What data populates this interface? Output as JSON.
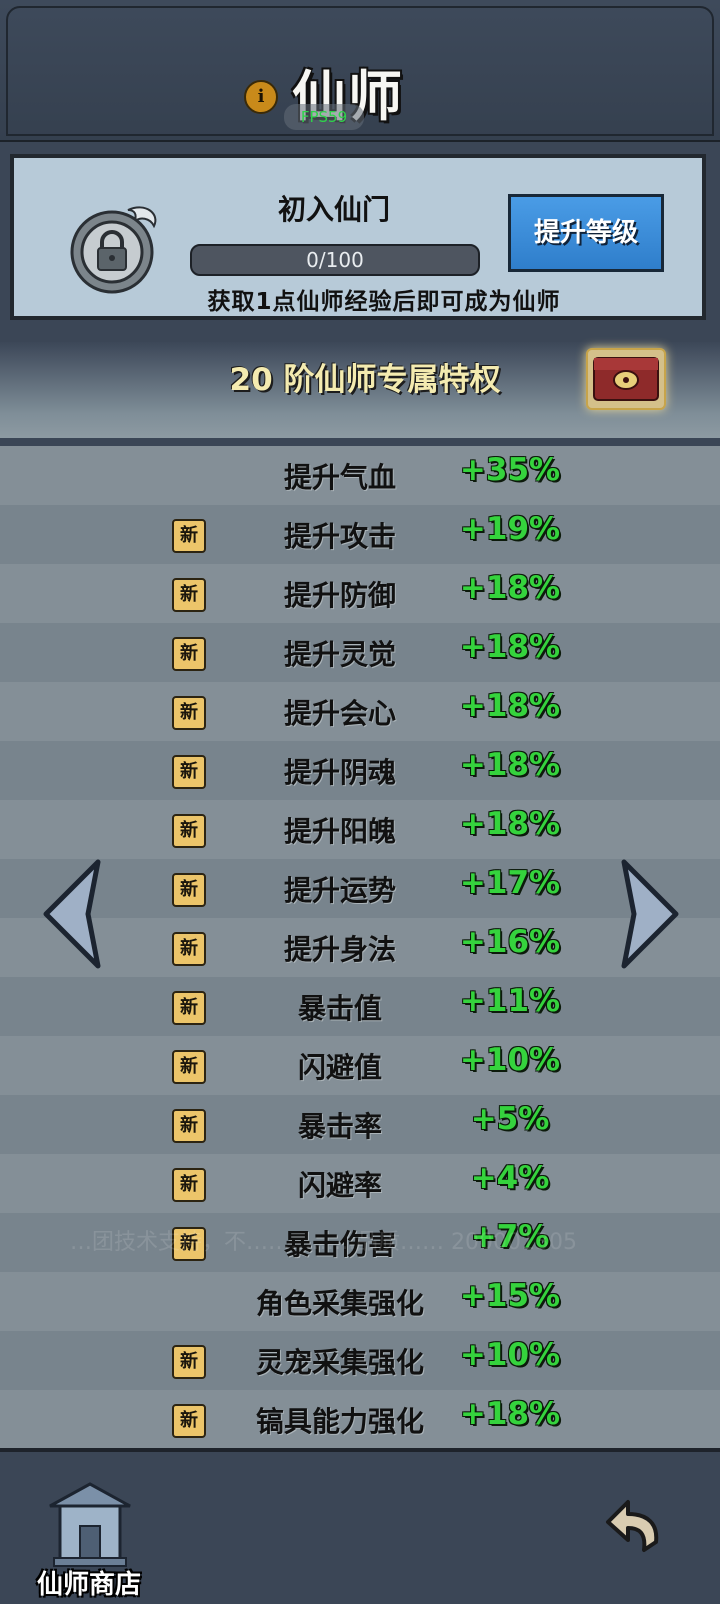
{
  "header": {
    "title": "仙师",
    "fps_label": "FPS59",
    "info_icon": "info-icon"
  },
  "level_panel": {
    "rank_name": "初入仙门",
    "progress_text": "0/100",
    "progress_fraction": 0.0,
    "upgrade_button_label": "提升等级",
    "hint": "获取1点仙师经验后即可成为仙师"
  },
  "privilege": {
    "title": "20 阶仙师专属特权",
    "chest_icon": "treasure-chest-icon"
  },
  "stats": [
    {
      "name": "提升气血",
      "value": "+35%",
      "is_new": false
    },
    {
      "name": "提升攻击",
      "value": "+19%",
      "is_new": true
    },
    {
      "name": "提升防御",
      "value": "+18%",
      "is_new": true
    },
    {
      "name": "提升灵觉",
      "value": "+18%",
      "is_new": true
    },
    {
      "name": "提升会心",
      "value": "+18%",
      "is_new": true
    },
    {
      "name": "提升阴魂",
      "value": "+18%",
      "is_new": true
    },
    {
      "name": "提升阳魄",
      "value": "+18%",
      "is_new": true
    },
    {
      "name": "提升运势",
      "value": "+17%",
      "is_new": true
    },
    {
      "name": "提升身法",
      "value": "+16%",
      "is_new": true
    },
    {
      "name": "暴击值",
      "value": "+11%",
      "is_new": true
    },
    {
      "name": "闪避值",
      "value": "+10%",
      "is_new": true
    },
    {
      "name": "暴击率",
      "value": "+5%",
      "is_new": true
    },
    {
      "name": "闪避率",
      "value": "+4%",
      "is_new": true
    },
    {
      "name": "暴击伤害",
      "value": "+7%",
      "is_new": true
    },
    {
      "name": "角色采集强化",
      "value": "+15%",
      "is_new": false
    },
    {
      "name": "灵宠采集强化",
      "value": "+10%",
      "is_new": true
    },
    {
      "name": "镐具能力强化",
      "value": "+18%",
      "is_new": true
    }
  ],
  "new_badge_label": "新",
  "watermark": "…团技术支持，不……………品质…… 200001305",
  "bottom": {
    "shop_label": "仙师商店",
    "back_icon": "return-arrow-icon"
  },
  "colors": {
    "stat_value": "#35d33d",
    "privilege_title": "#f4ebb0",
    "upgrade_button": "#3a8ad8",
    "card_background": "#b7cad8"
  }
}
